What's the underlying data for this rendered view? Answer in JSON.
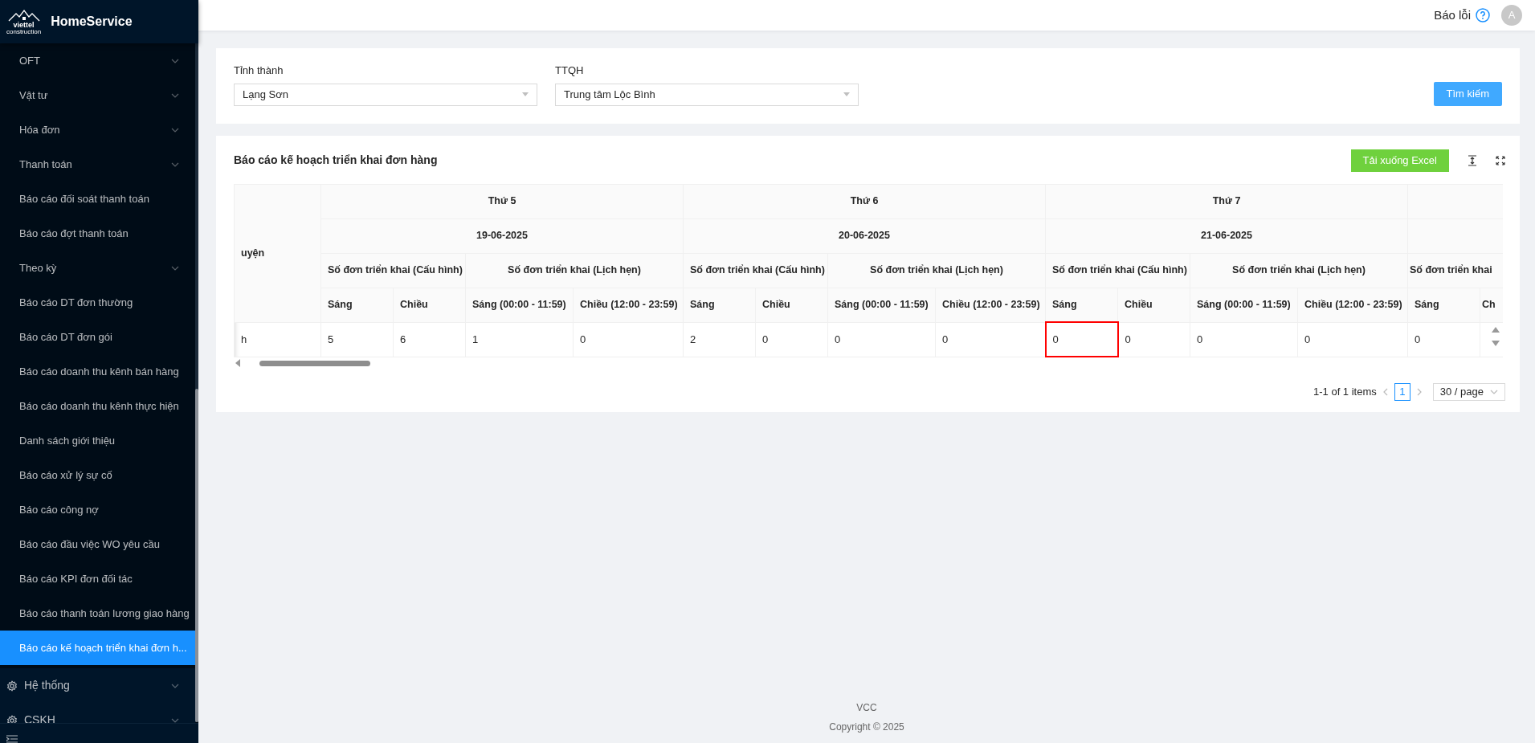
{
  "sidebar": {
    "brand": "HomeService",
    "logo_texts": [
      "viettel",
      "construction"
    ],
    "items": [
      {
        "label": "OFT",
        "kind": "submenu",
        "selected": false
      },
      {
        "label": "Vật tư",
        "kind": "submenu",
        "selected": false
      },
      {
        "label": "Hóa đơn",
        "kind": "submenu",
        "selected": false
      },
      {
        "label": "Thanh toán",
        "kind": "submenu",
        "selected": false
      },
      {
        "label": "Báo cáo đối soát thanh toán",
        "kind": "link",
        "selected": false
      },
      {
        "label": "Báo cáo đợt thanh toán",
        "kind": "link",
        "selected": false
      },
      {
        "label": "Theo kỳ",
        "kind": "submenu",
        "selected": false
      },
      {
        "label": "Báo cáo DT đơn thường",
        "kind": "link",
        "selected": false
      },
      {
        "label": "Báo cáo DT đơn gói",
        "kind": "link",
        "selected": false
      },
      {
        "label": "Báo cáo doanh thu kênh bán hàng",
        "kind": "link",
        "selected": false
      },
      {
        "label": "Báo cáo doanh thu kênh thực hiện",
        "kind": "link",
        "selected": false
      },
      {
        "label": "Danh sách giới thiệu",
        "kind": "link",
        "selected": false
      },
      {
        "label": "Báo cáo xử lý sự cố",
        "kind": "link",
        "selected": false
      },
      {
        "label": "Báo cáo công nợ",
        "kind": "link",
        "selected": false
      },
      {
        "label": "Báo cáo đầu việc WO yêu cầu",
        "kind": "link",
        "selected": false
      },
      {
        "label": "Báo cáo KPI đơn đối tác",
        "kind": "link",
        "selected": false
      },
      {
        "label": "Báo cáo thanh toán lương giao hàng",
        "kind": "link",
        "selected": false
      },
      {
        "label": "Báo cáo kế hoạch triển khai đơn h...",
        "kind": "link",
        "selected": true
      },
      {
        "label": "Hệ thống",
        "kind": "group",
        "selected": false
      },
      {
        "label": "CSKH",
        "kind": "group",
        "selected": false
      }
    ]
  },
  "header": {
    "report_error": "Báo lỗi",
    "avatar": "A"
  },
  "filters": {
    "fields": [
      {
        "label": "Tỉnh thành",
        "value": "Lạng Sơn"
      },
      {
        "label": "TTQH",
        "value": "Trung tâm Lộc Bình"
      }
    ],
    "search_button": "Tìm kiếm"
  },
  "report": {
    "title": "Báo cáo kế hoạch triển khai đơn hàng",
    "excel_button": "Tải xuống Excel",
    "table": {
      "first_column": "uyện",
      "days": [
        {
          "day": "Thứ 5",
          "date": "19-06-2025",
          "groups": [
            {
              "title": "Số đơn triển khai (Cấu hình)",
              "columns": [
                "Sáng",
                "Chiều"
              ]
            },
            {
              "title": "Số đơn triển khai (Lịch hẹn)",
              "columns": [
                "Sáng (00:00 - 11:59)",
                "Chiều (12:00 - 23:59)"
              ]
            }
          ]
        },
        {
          "day": "Thứ 6",
          "date": "20-06-2025",
          "groups": [
            {
              "title": "Số đơn triển khai (Cấu hình)",
              "columns": [
                "Sáng",
                "Chiều"
              ]
            },
            {
              "title": "Số đơn triển khai (Lịch hẹn)",
              "columns": [
                "Sáng (00:00 - 11:59)",
                "Chiều (12:00 - 23:59)"
              ]
            }
          ]
        },
        {
          "day": "Thứ 7",
          "date": "21-06-2025",
          "groups": [
            {
              "title": "Số đơn triển khai (Cấu hình)",
              "columns": [
                "Sáng",
                "Chiều"
              ]
            },
            {
              "title": "Số đơn triển khai (Lịch hẹn)",
              "columns": [
                "Sáng (00:00 - 11:59)",
                "Chiều (12:00 - 23:59)"
              ]
            }
          ]
        },
        {
          "groups": [
            {
              "title": "Số đơn triển khai",
              "columns": [
                "Sáng",
                "Ch"
              ]
            }
          ]
        }
      ],
      "rows": [
        {
          "cells": [
            {
              "text": "h",
              "selected": false
            },
            {
              "text": "5",
              "selected": false
            },
            {
              "text": "6",
              "selected": false
            },
            {
              "text": "1",
              "selected": false
            },
            {
              "text": "0",
              "selected": false
            },
            {
              "text": "2",
              "selected": false
            },
            {
              "text": "0",
              "selected": false
            },
            {
              "text": "0",
              "selected": false
            },
            {
              "text": "0",
              "selected": false
            },
            {
              "text": "0",
              "selected": true
            },
            {
              "text": "0",
              "selected": false
            },
            {
              "text": "0",
              "selected": false
            },
            {
              "text": "0",
              "selected": false
            },
            {
              "text": "0",
              "selected": false
            }
          ]
        }
      ]
    },
    "pagination": {
      "summary": "1-1 of 1 items",
      "pages": [
        {
          "label": "1",
          "selected": true
        }
      ],
      "page_size": "30 / page"
    }
  },
  "footer": {
    "lines": [
      "VCC",
      "Copyright © 2025"
    ]
  }
}
